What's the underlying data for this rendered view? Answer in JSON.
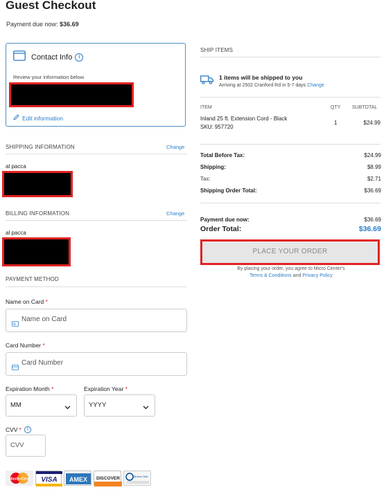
{
  "page": {
    "title": "Guest Checkout",
    "payment_due_label": "Payment due now:",
    "payment_due_value": "$36.69"
  },
  "contact": {
    "title": "Contact Info",
    "subtitle": "Review your information below",
    "edit_label": "Edit information"
  },
  "shipping_info": {
    "heading": "SHIPPING INFORMATION",
    "change_label": "Change",
    "name": "al pacca"
  },
  "billing_info": {
    "heading": "BILLING INFORMATION",
    "change_label": "Change",
    "name": "al pacca"
  },
  "payment_method": {
    "heading": "PAYMENT METHOD",
    "name_on_card": {
      "label": "Name on Card",
      "placeholder": "Name on Card"
    },
    "card_number": {
      "label": "Card Number",
      "placeholder": "Card Number"
    },
    "exp_month": {
      "label": "Expiration Month",
      "value": "MM"
    },
    "exp_year": {
      "label": "Expiration Year",
      "value": "YYYY"
    },
    "cvv": {
      "label": "CVV",
      "placeholder": "CVV"
    },
    "required_mark": "*",
    "card_brands": [
      "MasterCard",
      "VISA",
      "AMEX",
      "DISCOVER",
      "Diners Club"
    ]
  },
  "ship_items": {
    "heading": "SHIP ITEMS",
    "message": "1 items will be shipped to you",
    "arriving": "Arriving at 2502 Cranford Rd in 5-7 days",
    "change_label": "Change",
    "columns": {
      "item": "ITEM",
      "qty": "QTY",
      "subtotal": "SUBTOTAL"
    },
    "items": [
      {
        "name": "Inland 25 ft. Extension Cord - Black",
        "sku": "SKU: 957720",
        "qty": "1",
        "subtotal": "$24.99"
      }
    ]
  },
  "totals": {
    "before_tax_label": "Total Before Tax:",
    "before_tax_value": "$24.99",
    "shipping_label": "Shipping:",
    "shipping_value": "$8.99",
    "tax_label": "Tax:",
    "tax_value": "$2.71",
    "shipping_order_total_label": "Shipping Order Total:",
    "shipping_order_total_value": "$36.69",
    "payment_due_label": "Payment due now:",
    "payment_due_value": "$36.69",
    "order_total_label": "Order Total:",
    "order_total_value": "$36.69"
  },
  "place_order": {
    "button_label": "PLACE YOUR ORDER",
    "agree_prefix": "By placing your order, you agree to Micro Center's",
    "terms_link": "Terms & Conditions",
    "and_text": "and",
    "privacy_link": "Privacy Policy"
  },
  "colors": {
    "accent": "#2a7cc7",
    "redaction_border": "#e32222"
  },
  "icons": [
    "contact-card-icon",
    "info-icon",
    "pencil-icon",
    "truck-icon",
    "card-icon",
    "chevron-down-icon"
  ]
}
